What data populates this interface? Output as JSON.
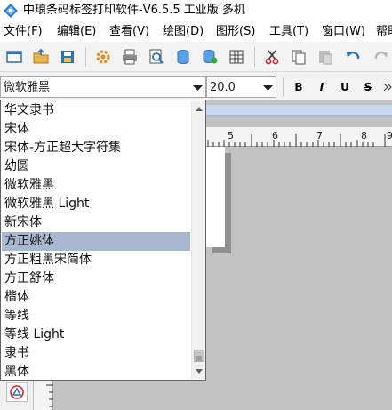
{
  "window": {
    "title": "中琅条码标签打印软件-V6.5.5 工业版 多机"
  },
  "menu": {
    "items": [
      {
        "label": "文件(F)"
      },
      {
        "label": "编辑(E)"
      },
      {
        "label": "查看(V)"
      },
      {
        "label": "绘图(D)"
      },
      {
        "label": "图形(S)"
      },
      {
        "label": "工具(T)"
      },
      {
        "label": "窗口(W)"
      },
      {
        "label": "帮助"
      }
    ]
  },
  "toolbar": {
    "icons": [
      "new-file-icon",
      "open-folder-icon",
      "save-icon",
      "settings-gear-icon",
      "print-icon",
      "print-preview-icon",
      "database-icon",
      "database-settings-icon",
      "grid-icon",
      "cut-icon",
      "copy-icon",
      "paste-icon",
      "undo-icon",
      "redo-icon"
    ]
  },
  "format": {
    "font_family": "微软雅黑",
    "font_size": "20.0",
    "buttons": [
      {
        "label": "B",
        "name": "bold-button"
      },
      {
        "label": "I",
        "name": "italic-button"
      },
      {
        "label": "U",
        "name": "underline-button"
      },
      {
        "label": "S",
        "name": "strikethrough-button"
      }
    ]
  },
  "ruler": {
    "labels": [
      "5",
      "6",
      "7",
      "8",
      "9"
    ]
  },
  "font_list": {
    "items": [
      "华文隶书",
      "宋体",
      "宋体-方正超大字符集",
      "幼圆",
      "微软雅黑",
      "微软雅黑 Light",
      "新宋体",
      "方正姚体",
      "方正粗黑宋简体",
      "方正舒体",
      "楷体",
      "等线",
      "等线 Light",
      "隶书",
      "黑体"
    ],
    "selected": "方正姚体",
    "scroll_position": 0.95
  },
  "colors": {
    "selection": "#a8b8d0",
    "workspace": "#c2c2c2",
    "ruler_band": "#c8d8ee"
  }
}
